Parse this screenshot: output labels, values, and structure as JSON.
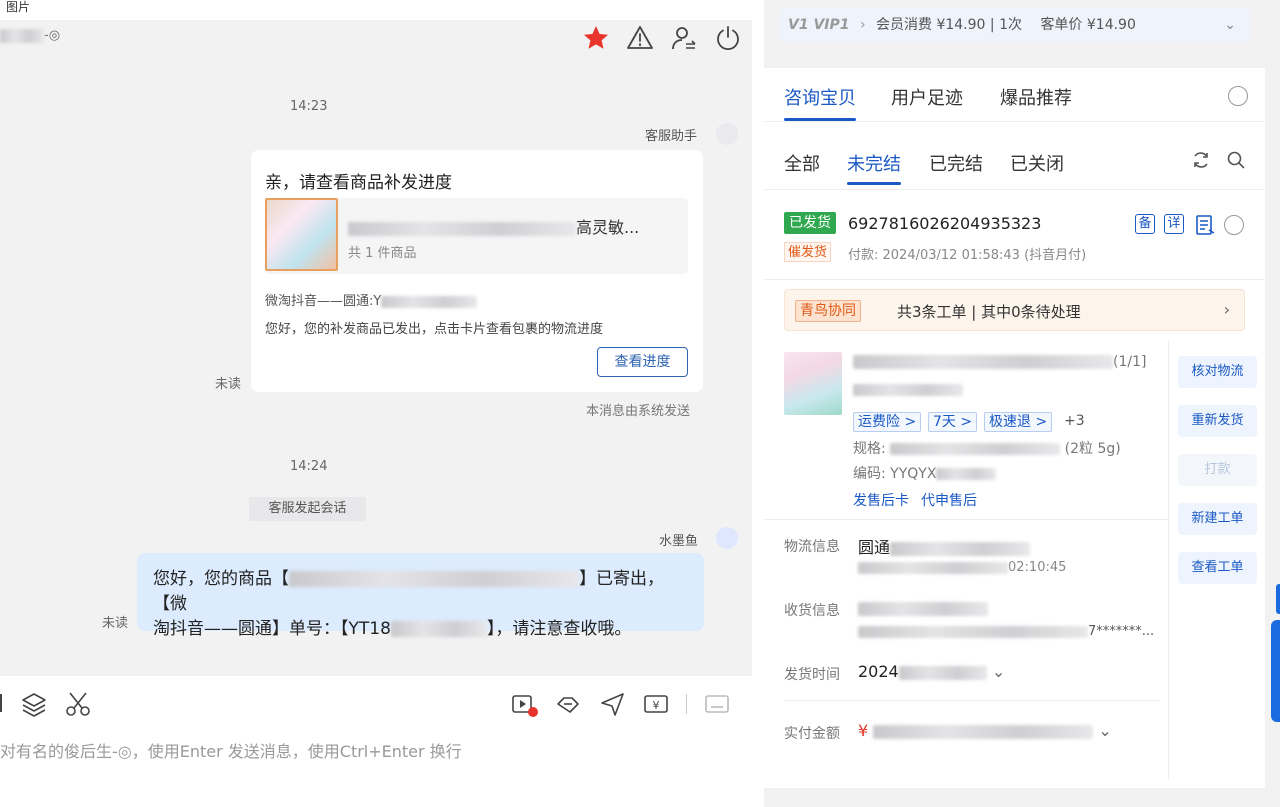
{
  "window": {
    "title": "图片"
  },
  "chat": {
    "contact_suffix": "-◎",
    "times": [
      "14:23",
      "14:24"
    ],
    "helper_sender": "客服助手",
    "card": {
      "title": "亲，请查看商品补发进度",
      "goods_name_tail": "高灵敏...",
      "goods_count": "共 1 件商品",
      "shipping_prefix": "微淘抖音——圆通:Y",
      "description": "您好，您的补发商品已发出，点击卡片查看包裹的物流进度",
      "button": "查看进度"
    },
    "unread": "未读",
    "system_note": "本消息由系统发送",
    "session_pill": "客服发起会话",
    "agent_name": "水墨鱼",
    "bubble": {
      "line1_prefix": "您好，您的商品【",
      "line1_suffix": "】已寄出，【微",
      "line2_prefix": "淘抖音——圆通】单号：【YT18",
      "line2_suffix": "】，请注意查收哦。"
    },
    "composer": {
      "placeholder": "对有名的俊后生-◎，使用Enter 发送消息，使用Ctrl+Enter 换行"
    }
  },
  "side": {
    "vip": {
      "level": "V1 VIP1",
      "spend": "会员消费 ¥14.90 | 1次",
      "unit_price": "客单价 ¥14.90"
    },
    "tabs": [
      "咨询宝贝",
      "用户足迹",
      "爆品推荐"
    ],
    "order_tabs": [
      "全部",
      "未完结",
      "已完结",
      "已关闭"
    ],
    "order": {
      "status": "已发货",
      "id": "6927816026204935323",
      "urge": "催发货",
      "pay_time": "付款: 2024/03/12 01:58:43 (抖音月付)",
      "icon_labels": [
        "备",
        "详"
      ]
    },
    "collab": {
      "tag": "青鸟协同",
      "text": "共3条工单 | 其中0条待处理"
    },
    "product": {
      "index": "(1/1]",
      "tags": [
        "运费险 >",
        "7天 >",
        "极速退 >",
        "+3"
      ],
      "spec_label": "规格:",
      "spec_tail": "(2粒 5g)",
      "code_label": "编码:",
      "code_value": "YYQYX",
      "links": [
        "发售后卡",
        "代申售后"
      ]
    },
    "actions": [
      "核对物流",
      "重新发货",
      "打款",
      "新建工单",
      "查看工单"
    ],
    "info": {
      "logistics_label": "物流信息",
      "logistics_value": "圆通",
      "logistics_time": "02:10:45",
      "receiver_label": "收货信息",
      "receiver_tail": "7*******...",
      "ship_time_label": "发货时间",
      "ship_time_value": "2024",
      "paid_label": "实付金额",
      "paid_currency": "¥"
    }
  }
}
